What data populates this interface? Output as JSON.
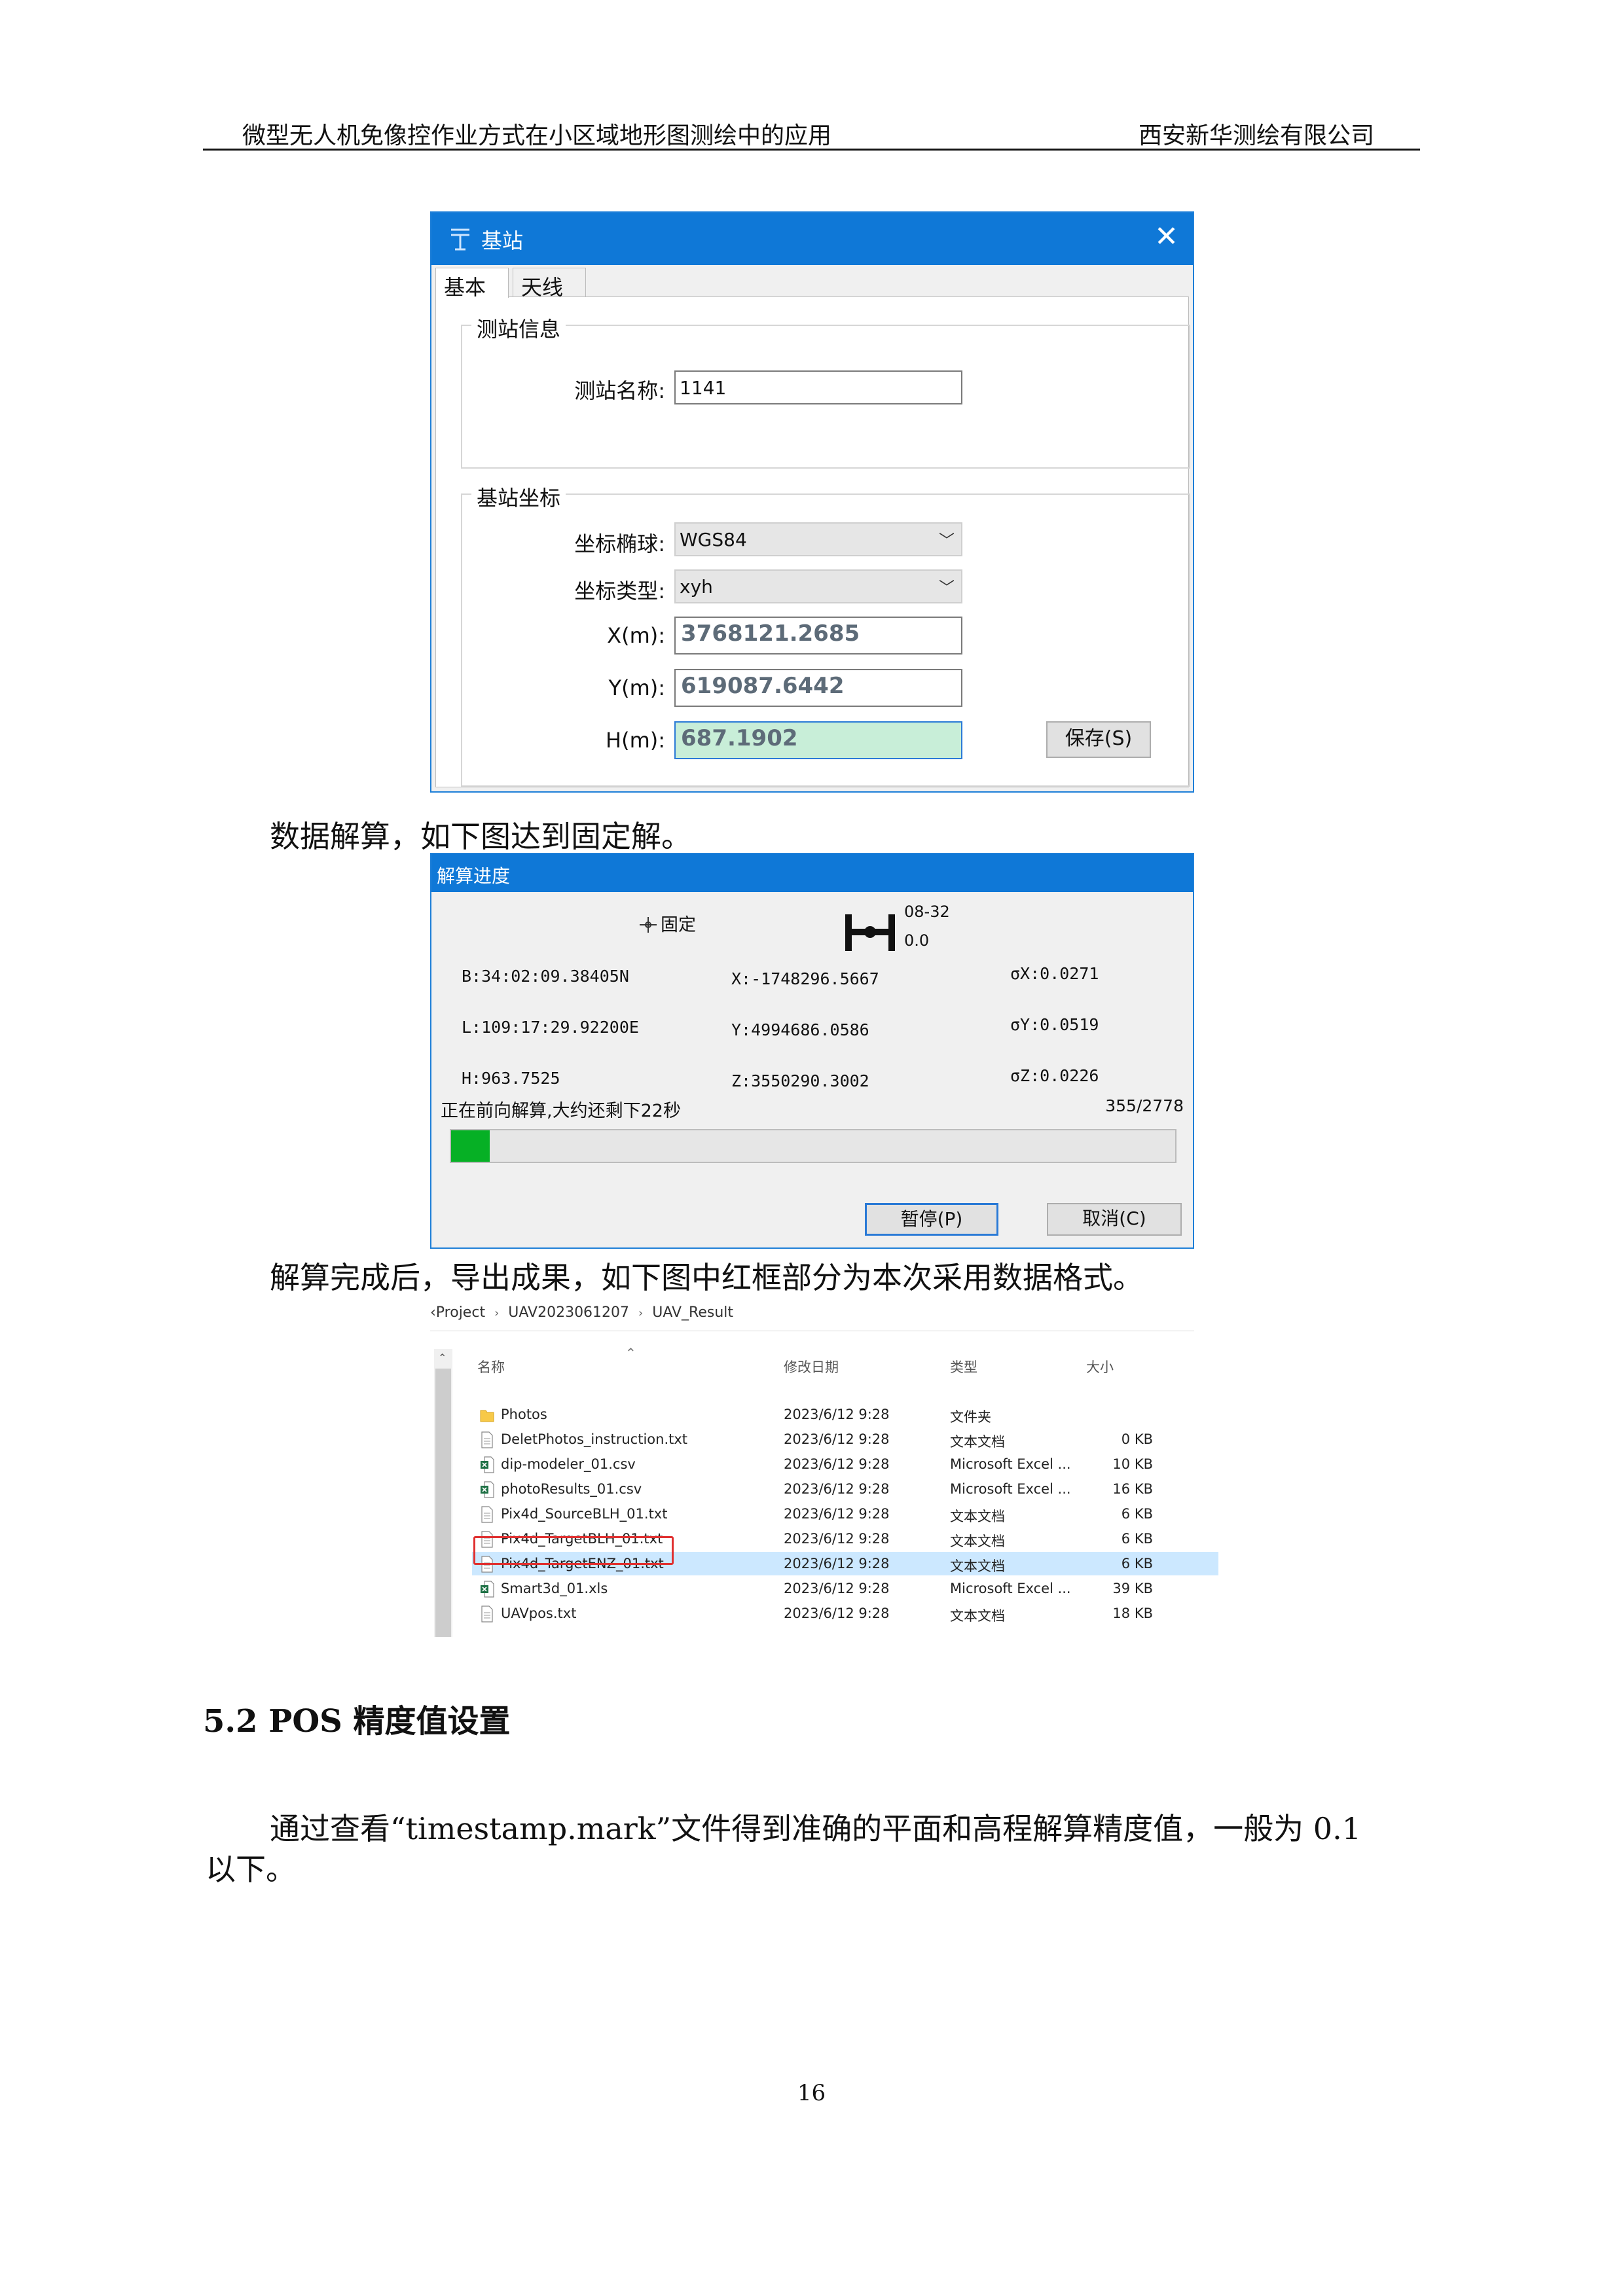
{
  "header": {
    "left": "微型无人机免像控作业方式在小区域地形图测绘中的应用",
    "right": "西安新华测绘有限公司"
  },
  "base_station_dialog": {
    "title": "基站",
    "close": "✕",
    "tabs": [
      "基本",
      "天线"
    ],
    "station_group": {
      "label": "测站信息",
      "name_label": "测站名称:",
      "name_value": "1141"
    },
    "coord_group": {
      "label": "基站坐标",
      "ellipsoid_label": "坐标椭球:",
      "ellipsoid_value": "WGS84",
      "type_label": "坐标类型:",
      "type_value": "xyh",
      "x_label": "X(m):",
      "x_value": "3768121.2685",
      "y_label": "Y(m):",
      "y_value": "619087.6442",
      "h_label": "H(m):",
      "h_value": "687.1902",
      "save_button": "保存(S)"
    }
  },
  "para1": "数据解算，如下图达到固定解。",
  "progress_dialog": {
    "title": "解算进度",
    "fix_label": "固定",
    "time_label": "08-32",
    "time_value": "0.0",
    "b": "B:34:02:09.38405N",
    "l": "L:109:17:29.92200E",
    "h": "H:963.7525",
    "x": "X:-1748296.5667",
    "y": "Y:4994686.0586",
    "z": "Z:3550290.3002",
    "sx": "σX:0.0271",
    "sy": "σY:0.0519",
    "sz": "σZ:0.0226",
    "status": "正在前向解算,大约还剩下22秒",
    "count": "355/2778",
    "progress_fraction": 0.0536,
    "pause_button": "暂停(P)",
    "cancel_button": "取消(C)"
  },
  "para2": "解算完成后，导出成果，如下图中红框部分为本次采用数据格式。",
  "explorer": {
    "breadcrumb": [
      "‹Project",
      "UAV2023061207",
      "UAV_Result"
    ],
    "columns": [
      "名称",
      "修改日期",
      "类型",
      "大小"
    ],
    "files": [
      {
        "name": "Photos",
        "date": "2023/6/12 9:28",
        "type": "文件夹",
        "size": "",
        "icon": "folder-icon"
      },
      {
        "name": "DeletPhotos_instruction.txt",
        "date": "2023/6/12 9:28",
        "type": "文本文档",
        "size": "0 KB",
        "icon": "text-file-icon"
      },
      {
        "name": "dip-modeler_01.csv",
        "date": "2023/6/12 9:28",
        "type": "Microsoft Excel ...",
        "size": "10 KB",
        "icon": "excel-file-icon"
      },
      {
        "name": "photoResults_01.csv",
        "date": "2023/6/12 9:28",
        "type": "Microsoft Excel ...",
        "size": "16 KB",
        "icon": "excel-file-icon"
      },
      {
        "name": "Pix4d_SourceBLH_01.txt",
        "date": "2023/6/12 9:28",
        "type": "文本文档",
        "size": "6 KB",
        "icon": "text-file-icon"
      },
      {
        "name": "Pix4d_TargetBLH_01.txt",
        "date": "2023/6/12 9:28",
        "type": "文本文档",
        "size": "6 KB",
        "icon": "text-file-icon"
      },
      {
        "name": "Pix4d_TargetENZ_01.txt",
        "date": "2023/6/12 9:28",
        "type": "文本文档",
        "size": "6 KB",
        "icon": "text-file-icon"
      },
      {
        "name": "Smart3d_01.xls",
        "date": "2023/6/12 9:28",
        "type": "Microsoft Excel ...",
        "size": "39 KB",
        "icon": "excel-file-icon"
      },
      {
        "name": "UAVpos.txt",
        "date": "2023/6/12 9:28",
        "type": "文本文档",
        "size": "18 KB",
        "icon": "text-file-icon"
      }
    ]
  },
  "section_title": "5.2 POS 精度值设置",
  "para3_line1": "通过查看“timestamp.mark”文件得到准确的平面和高程解算精度值，一般为 0.1",
  "para3_line2": "以下。",
  "page_number": "16"
}
